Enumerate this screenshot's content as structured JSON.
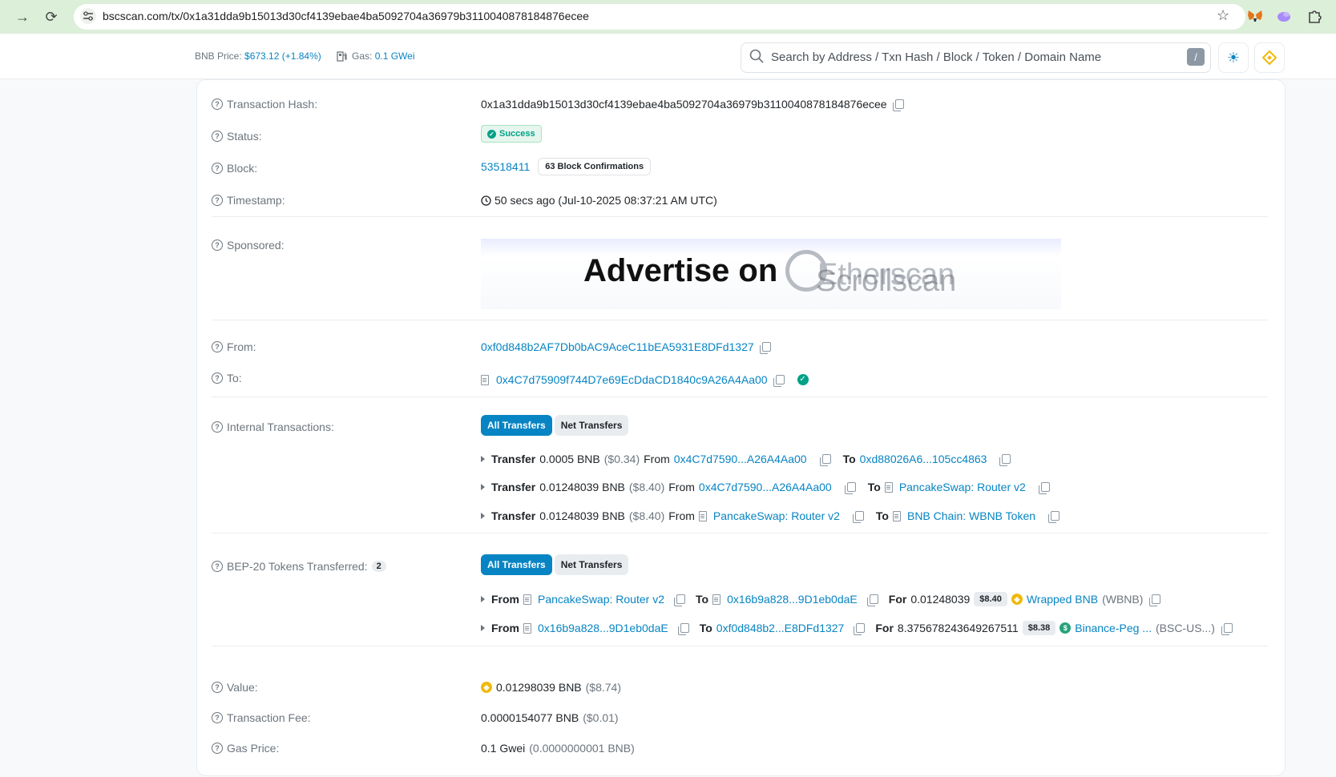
{
  "browser": {
    "url": "bscscan.com/tx/0x1a31dda9b15013d30cf4139ebae4ba5092704a36979b3110040878184876ecee"
  },
  "header": {
    "bnb_price_label": "BNB Price:",
    "bnb_price_value": "$673.12 (+1.84%)",
    "gas_label": "Gas:",
    "gas_value": "0.1 GWei",
    "search_placeholder": "Search by Address / Txn Hash / Block / Token / Domain Name",
    "search_shortcut": "/"
  },
  "tx": {
    "hash_label": "Transaction Hash:",
    "hash": "0x1a31dda9b15013d30cf4139ebae4ba5092704a36979b3110040878184876ecee",
    "status_label": "Status:",
    "status": "Success",
    "block_label": "Block:",
    "block": "53518411",
    "confirmations": "63 Block Confirmations",
    "timestamp_label": "Timestamp:",
    "timestamp": "50 secs ago (Jul-10-2025 08:37:21 AM UTC)",
    "sponsored_label": "Sponsored:",
    "ad_text": "Advertise on",
    "ad_brand_a": "Etherscan",
    "ad_brand_b": "Scrollscan",
    "from_label": "From:",
    "from": "0xf0d848b2AF7Db0bAC9AceC11bEA5931E8DFd1327",
    "to_label": "To:",
    "to": "0x4C7d75909f744D7e69EcDdaCD1840c9A26A4Aa00",
    "internal_label": "Internal Transactions:",
    "tab_all": "All Transfers",
    "tab_net": "Net Transfers",
    "internal": [
      {
        "verb": "Transfer",
        "amount": "0.0005 BNB",
        "usd": "($0.34)",
        "from_word": "From",
        "from": "0x4C7d7590...A26A4Aa00",
        "to_word": "To",
        "to": "0xd88026A6...105cc4863"
      },
      {
        "verb": "Transfer",
        "amount": "0.01248039 BNB",
        "usd": "($8.40)",
        "from_word": "From",
        "from": "0x4C7d7590...A26A4Aa00",
        "to_word": "To",
        "to": "PancakeSwap: Router v2"
      },
      {
        "verb": "Transfer",
        "amount": "0.01248039 BNB",
        "usd": "($8.40)",
        "from_word": "From",
        "from": "PancakeSwap: Router v2",
        "to_word": "To",
        "to": "BNB Chain: WBNB Token"
      }
    ],
    "bep20_label": "BEP-20 Tokens Transferred:",
    "bep20_count": "2",
    "bep20": [
      {
        "from_word": "From",
        "from": "PancakeSwap: Router v2",
        "to_word": "To",
        "to": "0x16b9a828...9D1eb0daE",
        "for_word": "For",
        "amount": "0.01248039",
        "usd": "$8.40",
        "token": "Wrapped BNB",
        "symbol": "(WBNB)"
      },
      {
        "from_word": "From",
        "from": "0x16b9a828...9D1eb0daE",
        "to_word": "To",
        "to": "0xf0d848b2...E8DFd1327",
        "for_word": "For",
        "amount": "8.375678243649267511",
        "usd": "$8.38",
        "token": "Binance-Peg ...",
        "symbol": "(BSC-US...)"
      }
    ],
    "value_label": "Value:",
    "value": "0.01298039 BNB",
    "value_usd": "($8.74)",
    "fee_label": "Transaction Fee:",
    "fee": "0.0000154077 BNB",
    "fee_usd": "($0.01)",
    "gas_price_label": "Gas Price:",
    "gas_price": "0.1 Gwei",
    "gas_price_bnb": "(0.0000000001 BNB)"
  },
  "colors": {
    "link": "#0784c3",
    "success": "#00a186",
    "browser_bar": "#dcefd9"
  }
}
